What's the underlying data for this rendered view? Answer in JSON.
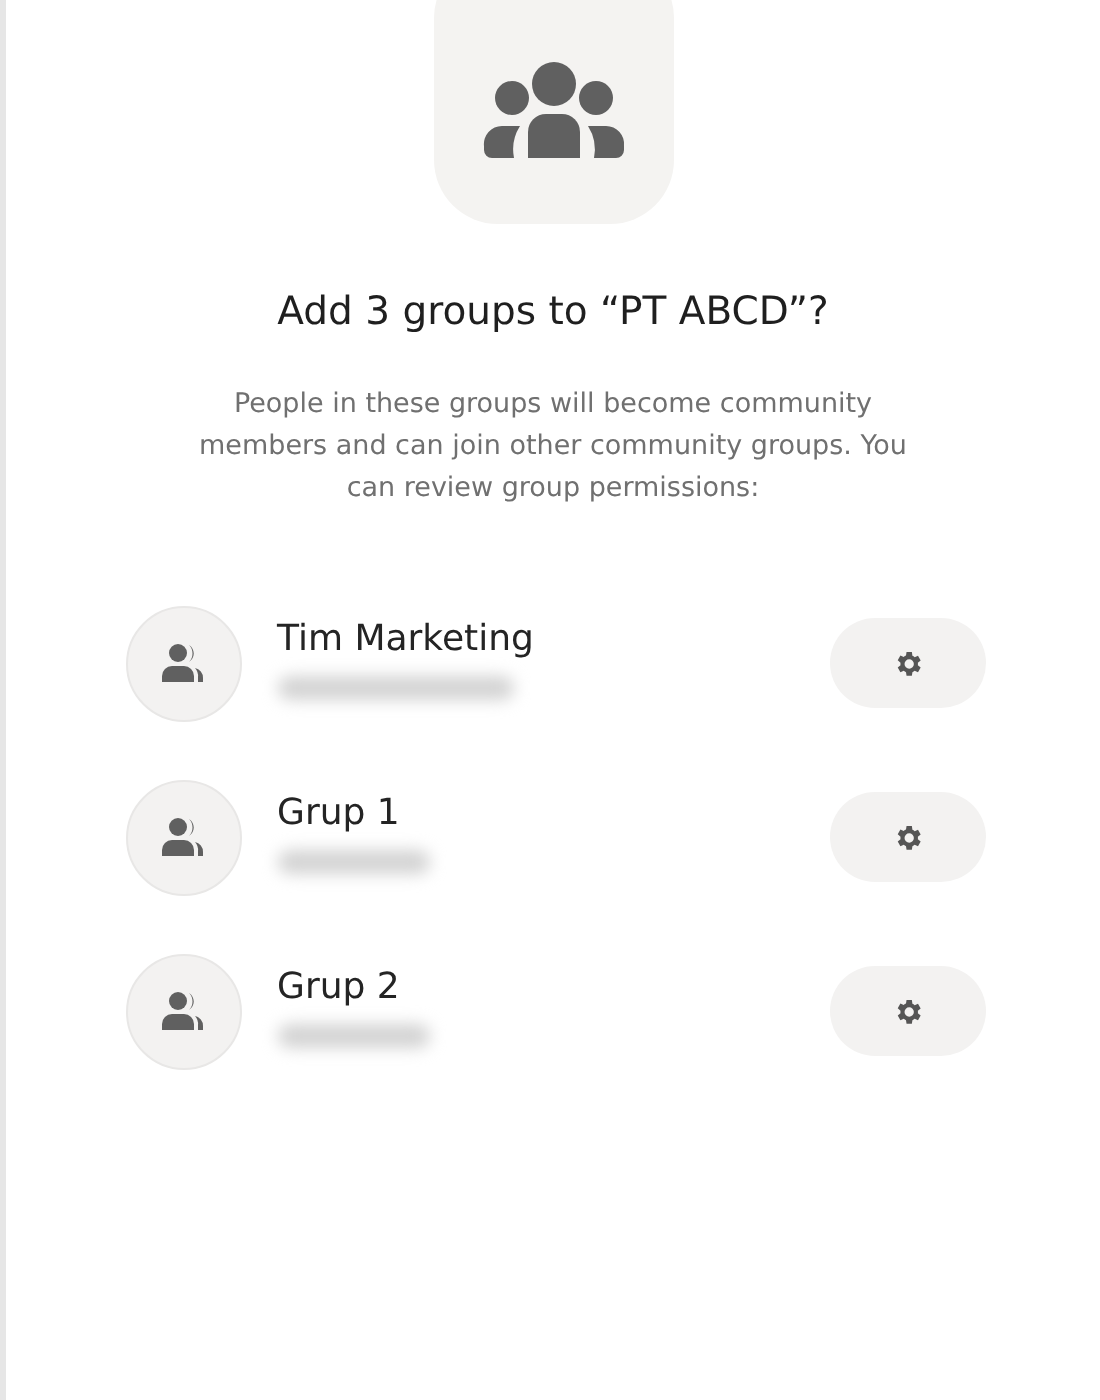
{
  "title": "Add 3 groups to “PT ABCD”?",
  "description": "People in these groups will become community members and can join other community groups. You can review group permissions:",
  "groups": [
    {
      "name": "Tim Marketing",
      "subtitle_blurred": true
    },
    {
      "name": "Grup 1",
      "subtitle_blurred": true
    },
    {
      "name": "Grup 2",
      "subtitle_blurred": true
    }
  ]
}
